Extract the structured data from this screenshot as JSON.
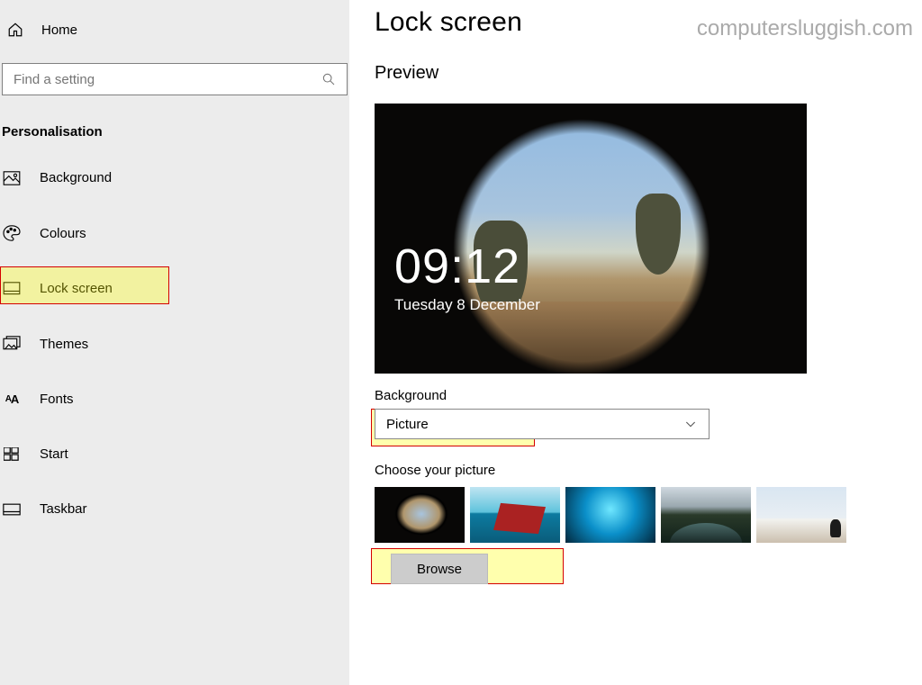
{
  "sidebar": {
    "home_label": "Home",
    "search_placeholder": "Find a setting",
    "section_title": "Personalisation",
    "items": [
      {
        "label": "Background"
      },
      {
        "label": "Colours"
      },
      {
        "label": "Lock screen"
      },
      {
        "label": "Themes"
      },
      {
        "label": "Fonts"
      },
      {
        "label": "Start"
      },
      {
        "label": "Taskbar"
      }
    ]
  },
  "main": {
    "page_title": "Lock screen",
    "watermark": "computersluggish.com",
    "preview_heading": "Preview",
    "preview_time": "09:12",
    "preview_date": "Tuesday 8 December",
    "background_label": "Background",
    "background_value": "Picture",
    "choose_label": "Choose your picture",
    "browse_label": "Browse"
  }
}
